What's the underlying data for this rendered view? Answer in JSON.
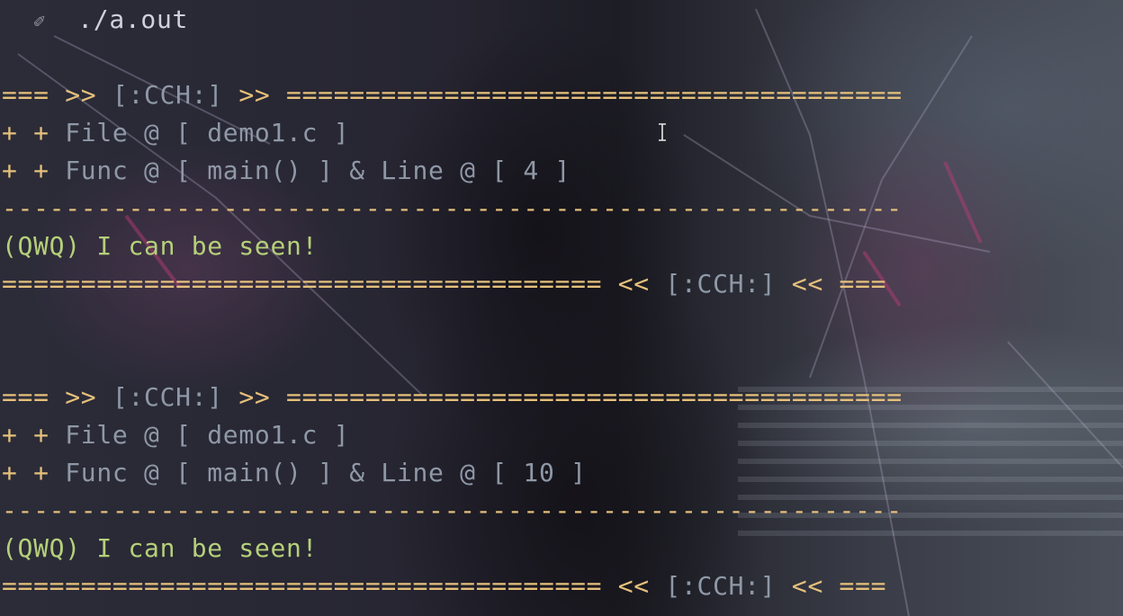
{
  "prompt": {
    "icon": "terminal-prompt-icon",
    "glyph": "✐",
    "command": "./a.out"
  },
  "blocks": [
    {
      "header_prefix": "=== >> ",
      "header_tag": "[:CCH:]",
      "header_suffix": " >> =======================================",
      "file_prefix": "+ + ",
      "file_label": "File @ [ demo1.c ]",
      "func_prefix": "+ + ",
      "func_label": "Func @ [ main() ] & Line @ [ 4 ]",
      "separator": "---------------------------------------------------------",
      "message": "(QWQ) I can be seen!",
      "footer_prefix": "====================================== << ",
      "footer_tag": "[:CCH:]",
      "footer_suffix": " << ==="
    },
    {
      "header_prefix": "=== >> ",
      "header_tag": "[:CCH:]",
      "header_suffix": " >> =======================================",
      "file_prefix": "+ + ",
      "file_label": "File @ [ demo1.c ]",
      "func_prefix": "+ + ",
      "func_label": "Func @ [ main() ] & Line @ [ 10 ]",
      "separator": "---------------------------------------------------------",
      "message": "(QWQ) I can be seen!",
      "footer_prefix": "====================================== << ",
      "footer_tag": "[:CCH:]",
      "footer_suffix": " << ==="
    }
  ],
  "colors": {
    "yellow": "#e5c07b",
    "gray": "#8f98a6",
    "green": "#b5d07a"
  }
}
